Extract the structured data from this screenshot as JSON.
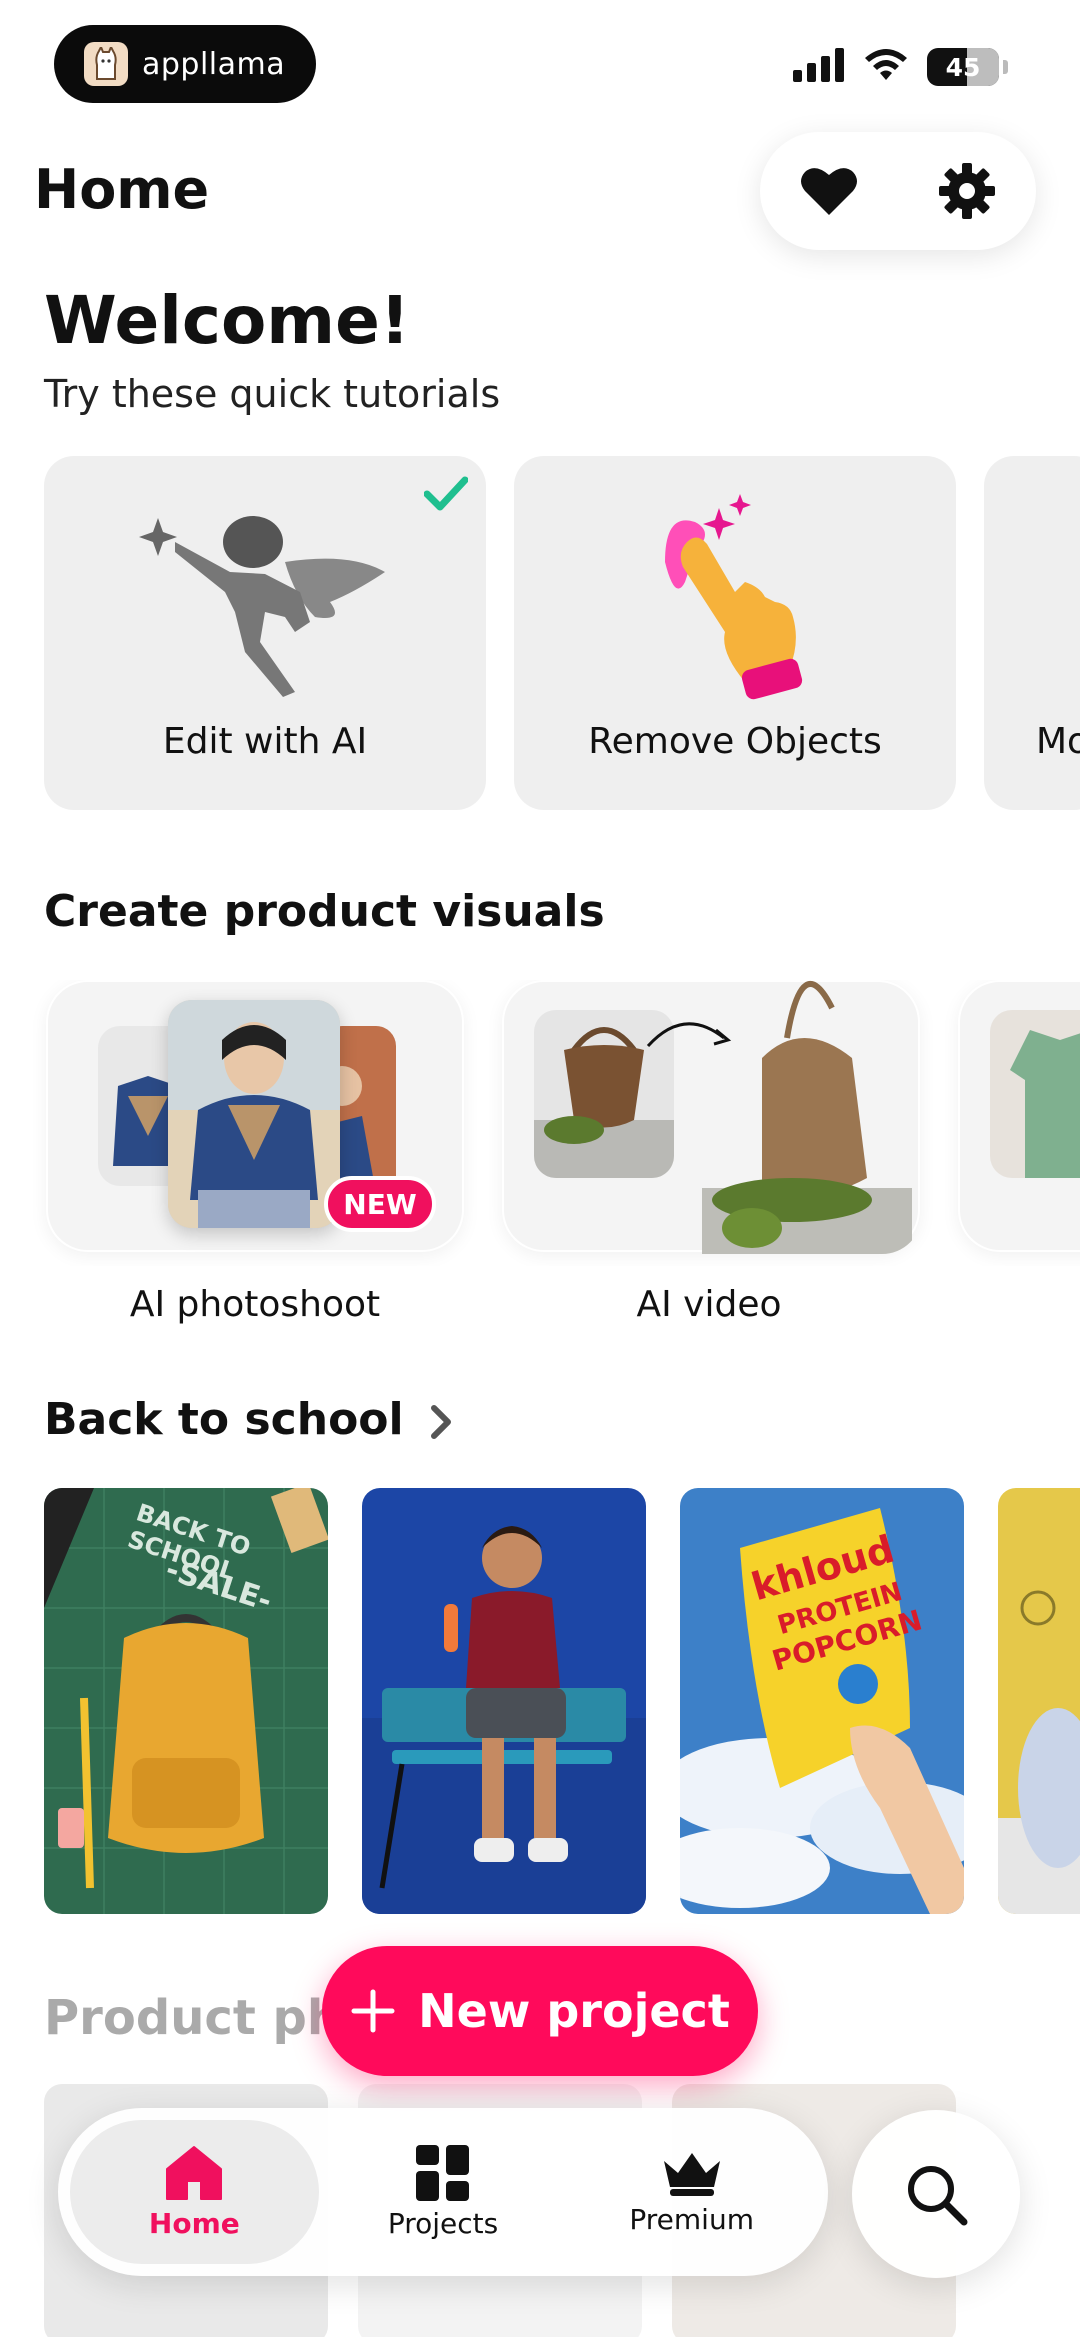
{
  "status_bar": {
    "brand_name": "appllama",
    "battery_level": "45",
    "icons": [
      "signal-icon",
      "wifi-icon",
      "battery-icon"
    ]
  },
  "header": {
    "title": "Home",
    "actions": [
      "heart-icon",
      "gear-icon"
    ]
  },
  "welcome": {
    "title": "Welcome!",
    "subtitle": "Try these quick tutorials"
  },
  "tutorials": [
    {
      "label": "Edit with AI",
      "completed": true
    },
    {
      "label": "Remove Objects",
      "completed": false
    },
    {
      "label": "Mo",
      "completed": false
    }
  ],
  "product_visuals": {
    "title": "Create product visuals",
    "items": [
      {
        "label": "AI photoshoot",
        "badge": "NEW"
      },
      {
        "label": "AI video"
      }
    ]
  },
  "back_to_school": {
    "title": "Back to school",
    "sale_text_1": "BACK TO SCHOOL",
    "sale_text_2": "-SALE-",
    "popcorn_brand": "khloud",
    "popcorn_line_1": "PROTEIN",
    "popcorn_line_2": "POPCORN"
  },
  "product_photos": {
    "title": "Product phot"
  },
  "fab": {
    "label": "New project"
  },
  "bottom_nav": {
    "items": [
      {
        "label": "Home",
        "icon": "home-icon",
        "active": true
      },
      {
        "label": "Projects",
        "icon": "grid-icon",
        "active": false
      },
      {
        "label": "Premium",
        "icon": "crown-icon",
        "active": false
      }
    ],
    "search_icon": "search-icon"
  },
  "colors": {
    "accent": "#f0105e",
    "check": "#1fbf8f"
  }
}
